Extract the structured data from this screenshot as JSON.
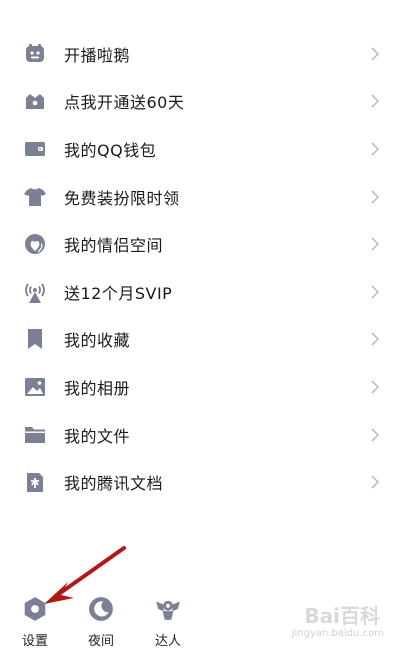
{
  "menu": {
    "items": [
      {
        "label": "开播啦鹅",
        "icon": "robot-face-icon"
      },
      {
        "label": "点我开通送60天",
        "icon": "crown-bag-icon"
      },
      {
        "label": "我的QQ钱包",
        "icon": "wallet-icon"
      },
      {
        "label": "免费装扮限时领",
        "icon": "tshirt-icon"
      },
      {
        "label": "我的情侣空间",
        "icon": "heart-bubble-icon"
      },
      {
        "label": "送12个月SVIP",
        "icon": "broadcast-tower-icon"
      },
      {
        "label": "我的收藏",
        "icon": "bookmark-icon"
      },
      {
        "label": "我的相册",
        "icon": "photo-icon"
      },
      {
        "label": "我的文件",
        "icon": "folder-icon"
      },
      {
        "label": "我的腾讯文档",
        "icon": "document-icon"
      }
    ]
  },
  "bottom": {
    "settings": "设置",
    "night": "夜间",
    "talent": "达人"
  },
  "watermark": {
    "logo": "Bai百科",
    "url": "jingyan.baidu.com"
  },
  "colors": {
    "icon": "#7b8095",
    "chevron": "#b8b8b8",
    "arrow": "#b01818"
  }
}
